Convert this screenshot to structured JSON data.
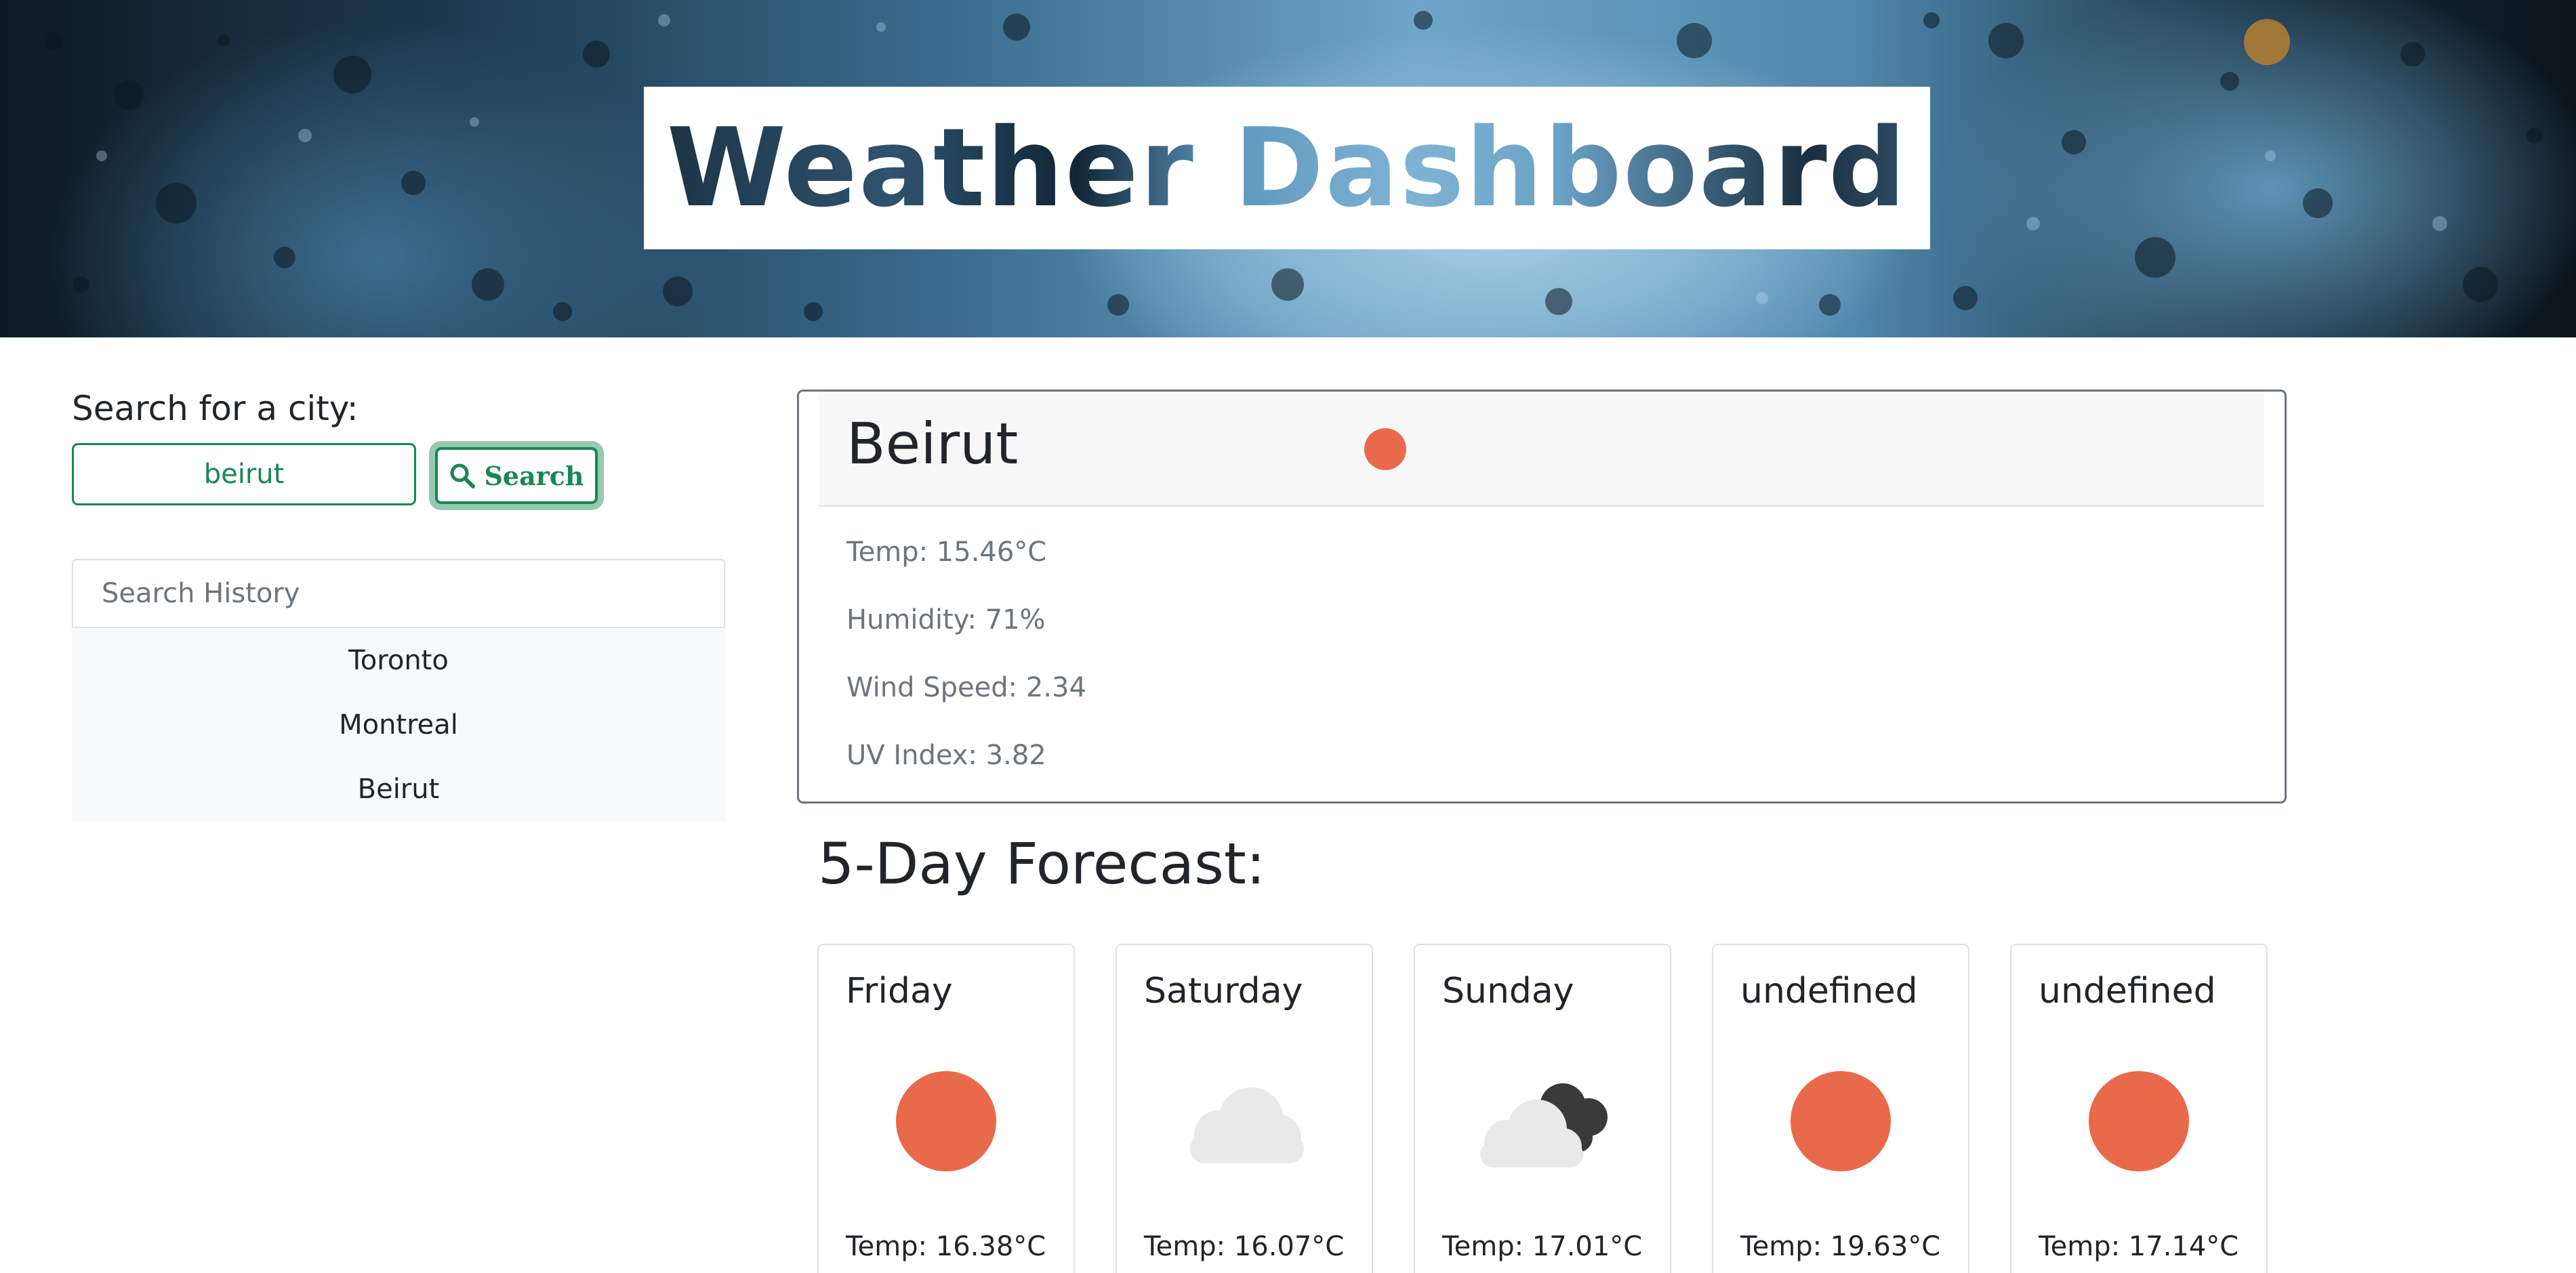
{
  "header": {
    "title": "Weather Dashboard"
  },
  "search": {
    "label": "Search for a city:",
    "value": "beirut",
    "button_label": "Search",
    "button_icon": "magnifier-icon"
  },
  "history": {
    "heading": "Search History",
    "items": [
      "Toronto",
      "Montreal",
      "Beirut"
    ]
  },
  "current": {
    "city": "Beirut",
    "icon": "sun-icon",
    "temp": "Temp: 15.46°C",
    "humidity": "Humidity: 71%",
    "wind": "Wind Speed: 2.34",
    "uv": "UV Index: 3.82"
  },
  "forecast": {
    "title": "5-Day Forecast:",
    "days": [
      {
        "day": "Friday",
        "icon": "sun-icon",
        "temp": "Temp: 16.38°C"
      },
      {
        "day": "Saturday",
        "icon": "cloud-icon",
        "temp": "Temp: 16.07°C"
      },
      {
        "day": "Sunday",
        "icon": "broken-clouds-icon",
        "temp": "Temp: 17.01°C"
      },
      {
        "day": "undefined",
        "icon": "sun-icon",
        "temp": "Temp: 19.63°C"
      },
      {
        "day": "undefined",
        "icon": "sun-icon",
        "temp": "Temp: 17.14°C"
      }
    ]
  },
  "colors": {
    "accent_green": "#198754",
    "sun": "#e96a4a",
    "cloud_light": "#e9e9e9",
    "cloud_dark": "#3a3a3a",
    "muted_text": "#6c757d"
  }
}
